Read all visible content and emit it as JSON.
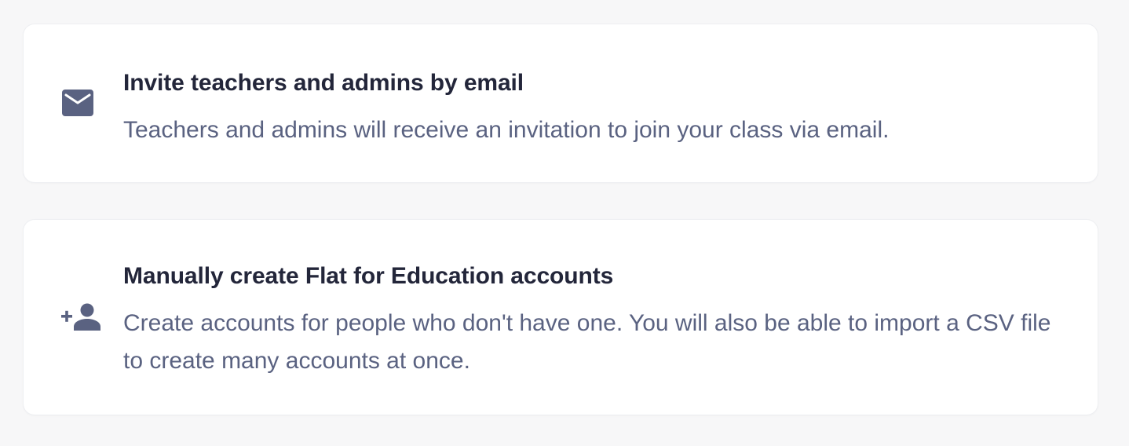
{
  "options": {
    "email_invite": {
      "icon": "envelope-icon",
      "title": "Invite teachers and admins by email",
      "description": "Teachers and admins will receive an invitation to join your class via email."
    },
    "manual_create": {
      "icon": "person-add-icon",
      "title": "Manually create Flat for Education accounts",
      "description": "Create accounts for people who don't have one. You will also be able to import a CSV file to create many accounts at once."
    }
  },
  "colors": {
    "background": "#f7f7f8",
    "card": "#ffffff",
    "title": "#23263a",
    "description": "#5a6281",
    "icon": "#5a6281"
  }
}
